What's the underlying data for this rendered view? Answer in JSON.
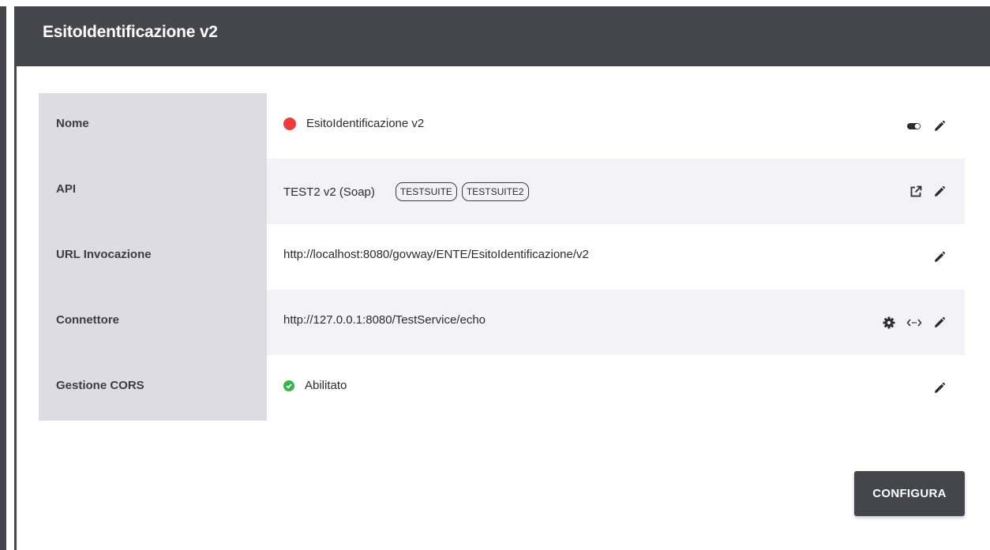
{
  "header": {
    "title": "EsitoIdentificazione v2"
  },
  "rows": [
    {
      "label": "Nome",
      "value": "EsitoIdentificazione v2",
      "status": "red-dot",
      "actions": [
        "toggle-icon",
        "pencil-icon"
      ]
    },
    {
      "label": "API",
      "value": "TEST2 v2 (Soap)",
      "tags": [
        "TESTSUITE",
        "TESTSUITE2"
      ],
      "actions": [
        "external-link-icon",
        "pencil-icon"
      ]
    },
    {
      "label": "URL Invocazione",
      "value": "http://localhost:8080/govway/ENTE/EsitoIdentificazione/v2",
      "actions": [
        "pencil-icon"
      ]
    },
    {
      "label": "Connettore",
      "value": "http://127.0.0.1:8080/TestService/echo",
      "actions": [
        "gear-icon",
        "code-arrows-icon",
        "pencil-icon"
      ]
    },
    {
      "label": "Gestione CORS",
      "value": "Abilitato",
      "status": "green-check",
      "actions": [
        "pencil-icon"
      ]
    }
  ],
  "button": {
    "configura": "CONFIGURA"
  },
  "colors": {
    "header_bg": "#45464c",
    "label_bg": "#dcdce2",
    "alt_row_bg": "#f3f3f7",
    "status_red": "#ef3b3b",
    "status_green": "#3ab54a"
  }
}
